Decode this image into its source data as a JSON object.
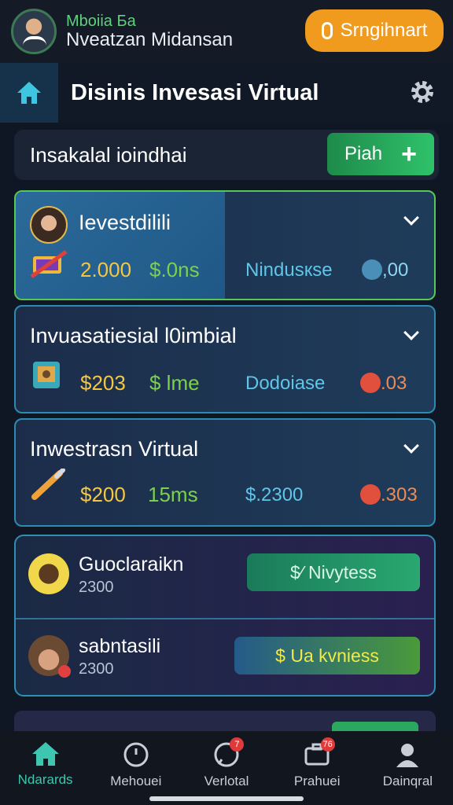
{
  "user": {
    "subtitle": "Mboiia Ба",
    "name": "Nveatzan Midansan"
  },
  "signin_button": {
    "label": "Srngihnart"
  },
  "header": {
    "title": "Disinis Invesasi Virtual"
  },
  "total": {
    "label": "Insakalal ioindhai",
    "add_label": "Piah",
    "add_symbol": "+"
  },
  "cards": [
    {
      "title": "Ievestdilili",
      "amount": "2.000",
      "rate": "$.0ns",
      "name": "Nindusкse",
      "value": ",00"
    },
    {
      "title": "Invuasatiesial l0imbial",
      "amount": "$203",
      "rate": "$ lme",
      "name": "Dodoiase",
      "value": ".03"
    },
    {
      "title": "Inwestrasn Virtual",
      "amount": "$200",
      "rate": "15ms",
      "name": "$.2300",
      "value": ".303"
    }
  ],
  "list": [
    {
      "name": "Guoclaraikn",
      "number": "2300",
      "button": "$⁄ Nivytess"
    },
    {
      "name": "sabntasili",
      "number": "2300",
      "button": "$ Ua kvniess"
    }
  ],
  "nav": [
    {
      "label": "Ndarards",
      "badge": ""
    },
    {
      "label": "Mehouei",
      "badge": ""
    },
    {
      "label": "Verlotal",
      "badge": "7"
    },
    {
      "label": "Prahuei",
      "badge": "76"
    },
    {
      "label": "Dainqral",
      "badge": ""
    }
  ],
  "colors": {
    "background": "#0f1624",
    "accent_orange": "#f09a1e",
    "accent_green": "#2fc26a",
    "card_border": "#2c8bb0",
    "active_nav": "#3ec6b0"
  }
}
